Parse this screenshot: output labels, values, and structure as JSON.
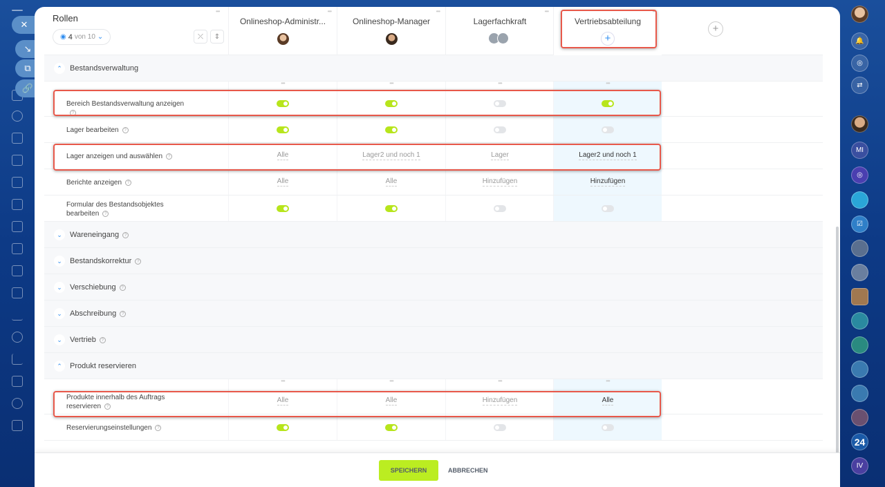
{
  "roles_header": {
    "title": "Rollen",
    "visible_count": "4",
    "visible_of": "von 10"
  },
  "columns": [
    {
      "name": "Onlineshop-Administr...",
      "assignee": "avatar"
    },
    {
      "name": "Onlineshop-Manager",
      "assignee": "avatar"
    },
    {
      "name": "Lagerfachkraft",
      "assignee": "group"
    },
    {
      "name": "Vertriebsabteilung",
      "assignee": "add",
      "add_label": "+"
    }
  ],
  "add_column_label": "+",
  "sections": [
    {
      "title": "Bestandsverwaltung",
      "expanded": true,
      "rows": [
        {
          "label": "Bereich Bestandsverwaltung anzeigen",
          "cells": [
            {
              "toggle": true
            },
            {
              "toggle": true
            },
            {
              "toggle": false
            },
            {
              "toggle": true
            }
          ]
        },
        {
          "label": "Lager bearbeiten",
          "cells": [
            {
              "toggle": true
            },
            {
              "toggle": true
            },
            {
              "toggle": false
            },
            {
              "toggle": false
            }
          ]
        },
        {
          "label": "Lager anzeigen und auswählen",
          "cells": [
            {
              "text": "Alle"
            },
            {
              "text": "Lager2 und noch 1"
            },
            {
              "text": "Lager"
            },
            {
              "text": "Lager2 und noch 1"
            }
          ]
        },
        {
          "label": "Berichte anzeigen",
          "cells": [
            {
              "text": "Alle"
            },
            {
              "text": "Alle"
            },
            {
              "text": "Hinzufügen"
            },
            {
              "text": "Hinzufügen"
            }
          ]
        },
        {
          "label": "Formular des Bestandsobjektes bearbeiten",
          "cells": [
            {
              "toggle": true
            },
            {
              "toggle": true
            },
            {
              "toggle": false
            },
            {
              "toggle": false
            }
          ]
        }
      ]
    },
    {
      "title": "Wareneingang",
      "expanded": false,
      "rows": []
    },
    {
      "title": "Bestandskorrektur",
      "expanded": false,
      "rows": []
    },
    {
      "title": "Verschiebung",
      "expanded": false,
      "rows": []
    },
    {
      "title": "Abschreibung",
      "expanded": false,
      "rows": []
    },
    {
      "title": "Vertrieb",
      "expanded": false,
      "rows": []
    },
    {
      "title": "Produkt reservieren",
      "expanded": true,
      "rows": [
        {
          "label": "Produkte innerhalb des Auftrags reservieren",
          "cells": [
            {
              "text": "Alle"
            },
            {
              "text": "Alle"
            },
            {
              "text": "Hinzufügen"
            },
            {
              "text": "Alle"
            }
          ]
        },
        {
          "label": "Reservierungseinstellungen",
          "cells": [
            {
              "toggle": true
            },
            {
              "toggle": true
            },
            {
              "toggle": false
            },
            {
              "toggle": false
            }
          ]
        }
      ]
    }
  ],
  "footer": {
    "save": "SPEICHERN",
    "cancel": "ABBRECHEN"
  },
  "right_sidebar": {
    "counter_badge": "24",
    "initials": [
      "MI",
      "IV"
    ]
  },
  "colors": {
    "accent": "#bbed21",
    "toggle_on": "#b7e51c",
    "highlight": "#e8584a",
    "link": "#2f8df0"
  }
}
